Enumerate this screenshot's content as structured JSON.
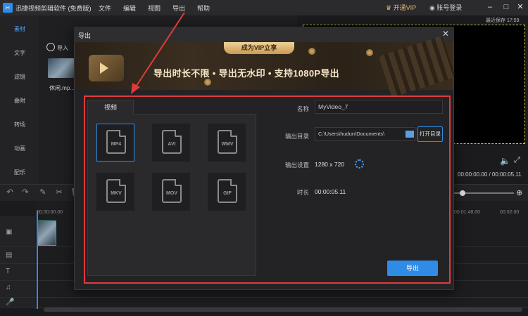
{
  "app": {
    "title": "迅捷视频剪辑软件 (免费版)",
    "menu": [
      "文件",
      "编辑",
      "视图",
      "导出",
      "帮助"
    ],
    "vip_label": "开通VIP",
    "login_label": "账号登录",
    "saved_label": "最近保存 17:59"
  },
  "sidebar": {
    "items": [
      "素材",
      "文字",
      "滤镜",
      "叠附",
      "转场",
      "动画",
      "配乐"
    ]
  },
  "media": {
    "import_label": "导入",
    "file_name": "休闲.mp..."
  },
  "preview": {
    "time_display": "00:00:00.00 / 00:00:05.11"
  },
  "timeline": {
    "ruler": [
      "00:00:00.00",
      "00:01:48.00",
      "00:02:00"
    ]
  },
  "dialog": {
    "title": "导出",
    "banner_badge": "成为VIP立享",
    "banner_text": "导出时长不限 • 导出无水印 • 支持1080P导出",
    "tab_video": "视频",
    "formats": [
      "MP4",
      "AVI",
      "WMV",
      "MKV",
      "MOV",
      "GIF"
    ],
    "selected_format": "MP4",
    "name_label": "名称",
    "name_value": "MyVideo_7",
    "output_dir_label": "输出目录",
    "output_dir_value": "C:\\Users\\hudun\\Documents\\",
    "open_dir_button": "打开目录",
    "output_settings_label": "输出设置",
    "output_settings_value": "1280 x 720",
    "duration_label": "时长",
    "duration_value": "00:00:05.11",
    "export_button": "导出"
  },
  "colors": {
    "accent": "#2f8be6",
    "highlight": "#e23a3a",
    "vip_gold": "#e6b86a"
  }
}
